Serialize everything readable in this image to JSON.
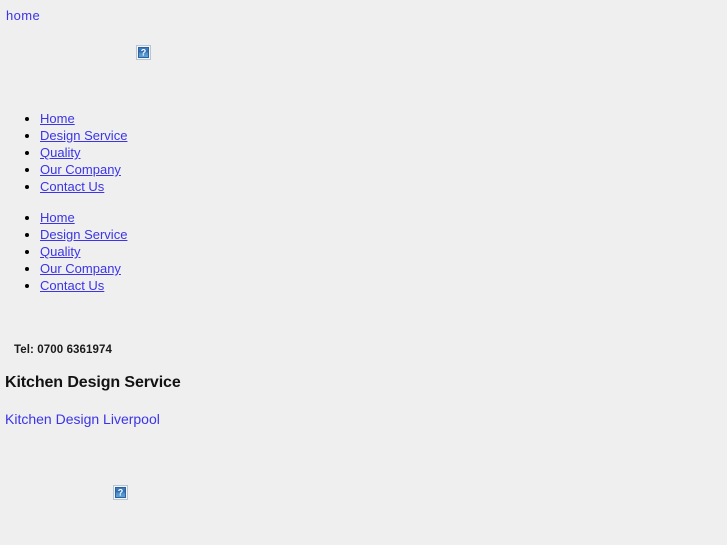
{
  "page": {
    "background_color": "#efefef",
    "link_color": "#3b34e8",
    "text_color": "#000000"
  },
  "top_link": {
    "label": "home"
  },
  "images": {
    "header_logo": {
      "icon": "broken-image-icon",
      "glyph": "?"
    },
    "footer_logo": {
      "icon": "broken-image-icon",
      "glyph": "?"
    }
  },
  "nav_primary": {
    "items": [
      {
        "label": "Home"
      },
      {
        "label": "Design Service"
      },
      {
        "label": "Quality"
      },
      {
        "label": "Our Company"
      },
      {
        "label": "Contact Us"
      }
    ]
  },
  "nav_secondary": {
    "items": [
      {
        "label": "Home"
      },
      {
        "label": "Design Service"
      },
      {
        "label": "Quality"
      },
      {
        "label": "Our Company"
      },
      {
        "label": "Contact Us"
      }
    ]
  },
  "contact": {
    "telephone": "Tel: 0700 6361974"
  },
  "heading": {
    "title": "Kitchen Design Service"
  },
  "footer_link": {
    "label": "Kitchen Design Liverpool"
  }
}
